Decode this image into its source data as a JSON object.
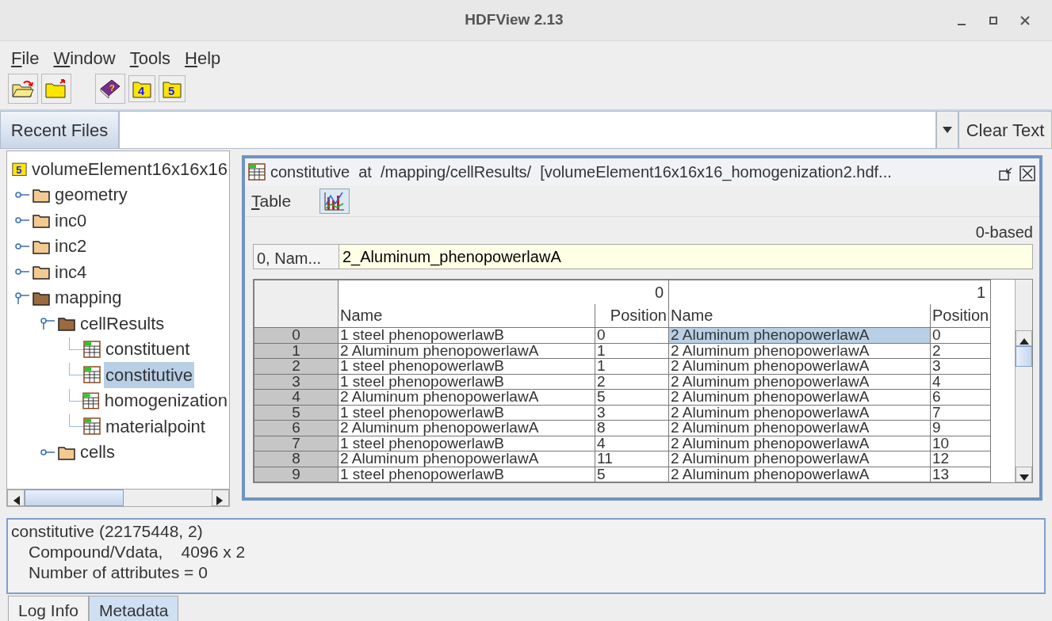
{
  "window": {
    "title": "HDFView 2.13"
  },
  "menu": [
    {
      "label": "File"
    },
    {
      "label": "Window"
    },
    {
      "label": "Tools"
    },
    {
      "label": "Help"
    }
  ],
  "toolbar": [
    {
      "kind": "open"
    },
    {
      "kind": "close"
    },
    {
      "kind": "gap"
    },
    {
      "kind": "help"
    },
    {
      "kind": "hdf4"
    },
    {
      "kind": "hdf5"
    }
  ],
  "toolbar_labels": {
    "hdf4": "4",
    "hdf5": "5",
    "help": "?"
  },
  "recent_files": {
    "label": "Recent Files",
    "clear": "Clear Text"
  },
  "tree": [
    {
      "label": "volumeElement16x16x16",
      "kind": "file",
      "icon_text": "5",
      "expanded": true,
      "selected": false,
      "children": [
        {
          "label": "geometry",
          "kind": "group",
          "expanded": false,
          "selected": false
        },
        {
          "label": "inc0",
          "kind": "group",
          "expanded": false,
          "selected": false
        },
        {
          "label": "inc2",
          "kind": "group",
          "expanded": false,
          "selected": false
        },
        {
          "label": "inc4",
          "kind": "group",
          "expanded": false,
          "selected": false
        },
        {
          "label": "mapping",
          "kind": "group",
          "expanded": true,
          "selected": false,
          "children": [
            {
              "label": "cellResults",
              "kind": "group",
              "expanded": true,
              "selected": false,
              "children": [
                {
                  "label": "constituent",
                  "kind": "dataset",
                  "selected": false
                },
                {
                  "label": "constitutive",
                  "kind": "dataset",
                  "selected": true
                },
                {
                  "label": "homogenization",
                  "kind": "dataset",
                  "selected": false
                },
                {
                  "label": "materialpoint",
                  "kind": "dataset",
                  "selected": false
                }
              ]
            },
            {
              "label": "cells",
              "kind": "group",
              "expanded": false,
              "selected": false
            }
          ]
        }
      ]
    }
  ],
  "frame": {
    "title": "constitutive  at  /mapping/cellResults/  [volumeElement16x16x16_homogenization2.hdf...",
    "menu": {
      "label": "Table"
    },
    "index_base": "0-based",
    "cell_ref": "0,  Nam...",
    "cell_value": "2_Aluminum_phenopowerlawA"
  },
  "table": {
    "groups": [
      "0",
      "1"
    ],
    "columns": [
      "Name",
      "Position",
      "Name",
      "Position"
    ],
    "rows": [
      {
        "header": "0",
        "cells": [
          {
            "text": "1  steel  phenopowerlawB",
            "selected": false
          },
          {
            "text": "0",
            "selected": false
          },
          {
            "text": "2  Aluminum  phenopowerlawA",
            "selected": true
          },
          {
            "text": "0",
            "selected": false
          }
        ]
      },
      {
        "header": "1",
        "cells": [
          {
            "text": "2  Aluminum  phenopowerlawA",
            "selected": false
          },
          {
            "text": "1",
            "selected": false
          },
          {
            "text": "2  Aluminum  phenopowerlawA",
            "selected": false
          },
          {
            "text": "2",
            "selected": false
          }
        ]
      },
      {
        "header": "2",
        "cells": [
          {
            "text": "1  steel  phenopowerlawB",
            "selected": false
          },
          {
            "text": "1",
            "selected": false
          },
          {
            "text": "2  Aluminum  phenopowerlawA",
            "selected": false
          },
          {
            "text": "3",
            "selected": false
          }
        ]
      },
      {
        "header": "3",
        "cells": [
          {
            "text": "1  steel  phenopowerlawB",
            "selected": false
          },
          {
            "text": "2",
            "selected": false
          },
          {
            "text": "2  Aluminum  phenopowerlawA",
            "selected": false
          },
          {
            "text": "4",
            "selected": false
          }
        ]
      },
      {
        "header": "4",
        "cells": [
          {
            "text": "2  Aluminum  phenopowerlawA",
            "selected": false
          },
          {
            "text": "5",
            "selected": false
          },
          {
            "text": "2  Aluminum  phenopowerlawA",
            "selected": false
          },
          {
            "text": "6",
            "selected": false
          }
        ]
      },
      {
        "header": "5",
        "cells": [
          {
            "text": "1  steel  phenopowerlawB",
            "selected": false
          },
          {
            "text": "3",
            "selected": false
          },
          {
            "text": "2  Aluminum  phenopowerlawA",
            "selected": false
          },
          {
            "text": "7",
            "selected": false
          }
        ]
      },
      {
        "header": "6",
        "cells": [
          {
            "text": "2  Aluminum  phenopowerlawA",
            "selected": false
          },
          {
            "text": "8",
            "selected": false
          },
          {
            "text": "2  Aluminum  phenopowerlawA",
            "selected": false
          },
          {
            "text": "9",
            "selected": false
          }
        ]
      },
      {
        "header": "7",
        "cells": [
          {
            "text": "1  steel  phenopowerlawB",
            "selected": false
          },
          {
            "text": "4",
            "selected": false
          },
          {
            "text": "2  Aluminum  phenopowerlawA",
            "selected": false
          },
          {
            "text": "10",
            "selected": false
          }
        ]
      },
      {
        "header": "8",
        "cells": [
          {
            "text": "2  Aluminum  phenopowerlawA",
            "selected": false
          },
          {
            "text": "11",
            "selected": false
          },
          {
            "text": "2  Aluminum  phenopowerlawA",
            "selected": false
          },
          {
            "text": "12",
            "selected": false
          }
        ]
      },
      {
        "header": "9",
        "cells": [
          {
            "text": "1  steel  phenopowerlawB",
            "selected": false
          },
          {
            "text": "5",
            "selected": false
          },
          {
            "text": "2  Aluminum  phenopowerlawA",
            "selected": false
          },
          {
            "text": "13",
            "selected": false
          }
        ]
      }
    ]
  },
  "info": [
    "constitutive (22175448, 2)",
    "Compound/Vdata,    4096 x 2",
    "Number of attributes = 0"
  ],
  "bottom_tabs": [
    {
      "label": "Log Info",
      "selected": false
    },
    {
      "label": "Metadata",
      "selected": true
    }
  ]
}
